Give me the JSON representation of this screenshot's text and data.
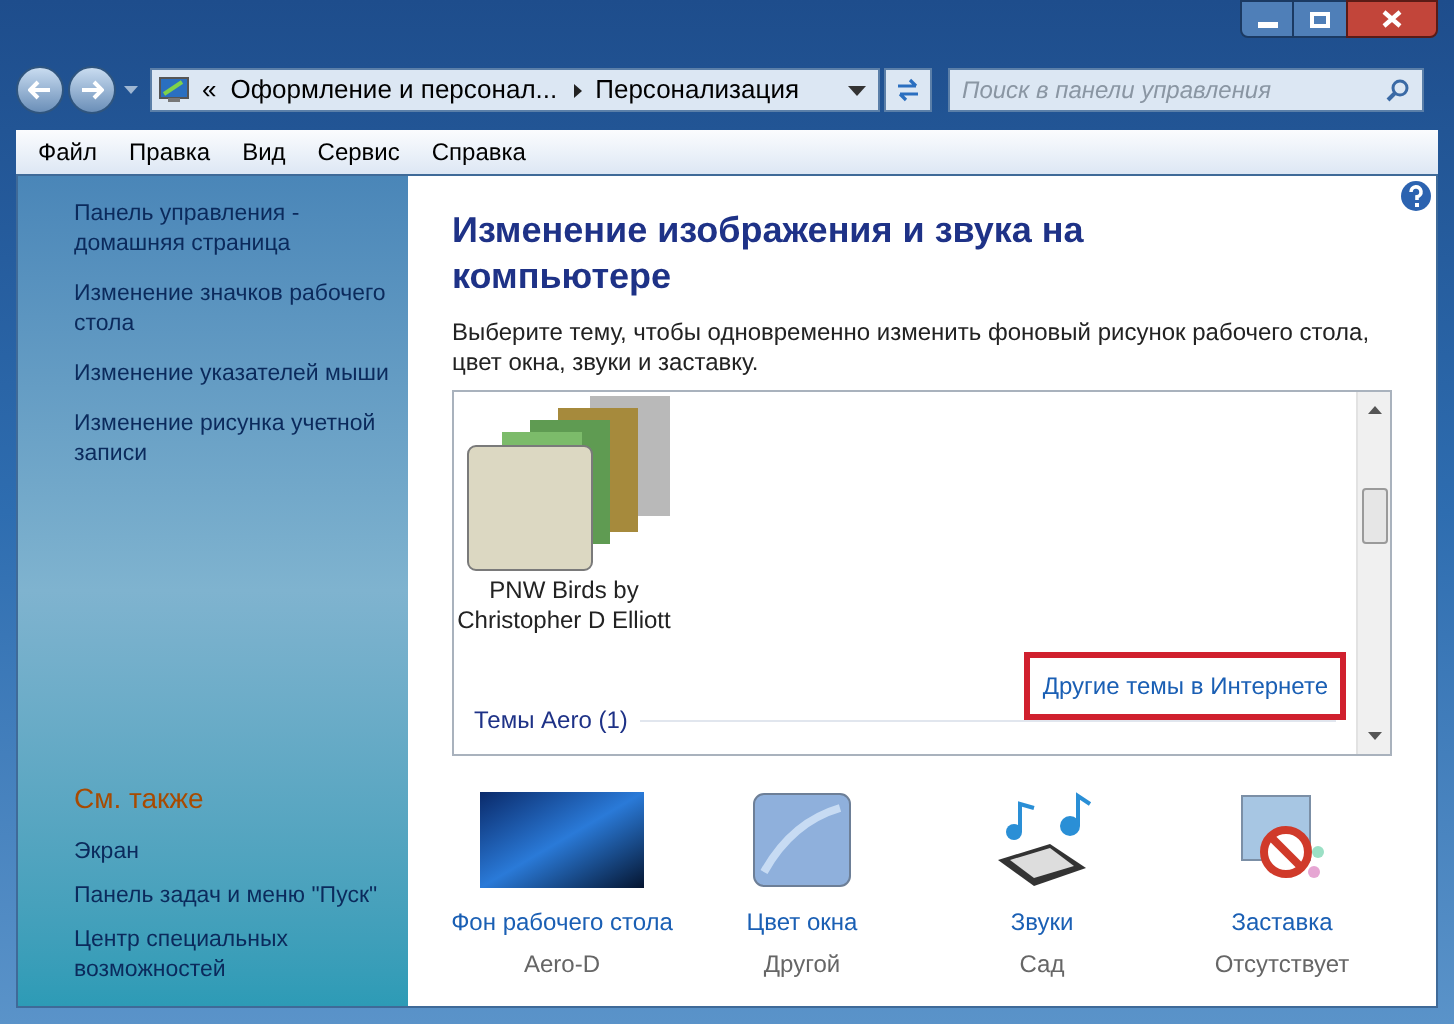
{
  "address_bar": {
    "overflow_chevron": "«",
    "breadcrumbs": [
      "Оформление и персонал...",
      "Персонализация"
    ],
    "search_placeholder": "Поиск в панели управления"
  },
  "menu": [
    "Файл",
    "Правка",
    "Вид",
    "Сервис",
    "Справка"
  ],
  "sidebar": {
    "links": [
      "Панель управления - домашняя страница",
      "Изменение значков рабочего стола",
      "Изменение указателей мыши",
      "Изменение рисунка учетной записи"
    ],
    "see_also_title": "См. также",
    "see_also": [
      "Экран",
      "Панель задач и меню \"Пуск\"",
      "Центр специальных возможностей"
    ]
  },
  "content": {
    "title": "Изменение изображения и звука на компьютере",
    "description": "Выберите тему, чтобы одновременно изменить фоновый рисунок рабочего стола, цвет окна, звуки и заставку.",
    "themes": [
      {
        "name": "PNW Birds by Christopher D Elliott"
      }
    ],
    "online_link": {
      "text": "Другие темы в Интернете",
      "highlighted": true
    },
    "group_label": "Темы Aero (1)",
    "settings": [
      {
        "kind": "background",
        "label": "Фон рабочего стола",
        "value": "Aero-D"
      },
      {
        "kind": "color",
        "label": "Цвет окна",
        "value": "Другой"
      },
      {
        "kind": "sounds",
        "label": "Звуки",
        "value": "Сад"
      },
      {
        "kind": "screensaver",
        "label": "Заставка",
        "value": "Отсутствует"
      }
    ]
  }
}
